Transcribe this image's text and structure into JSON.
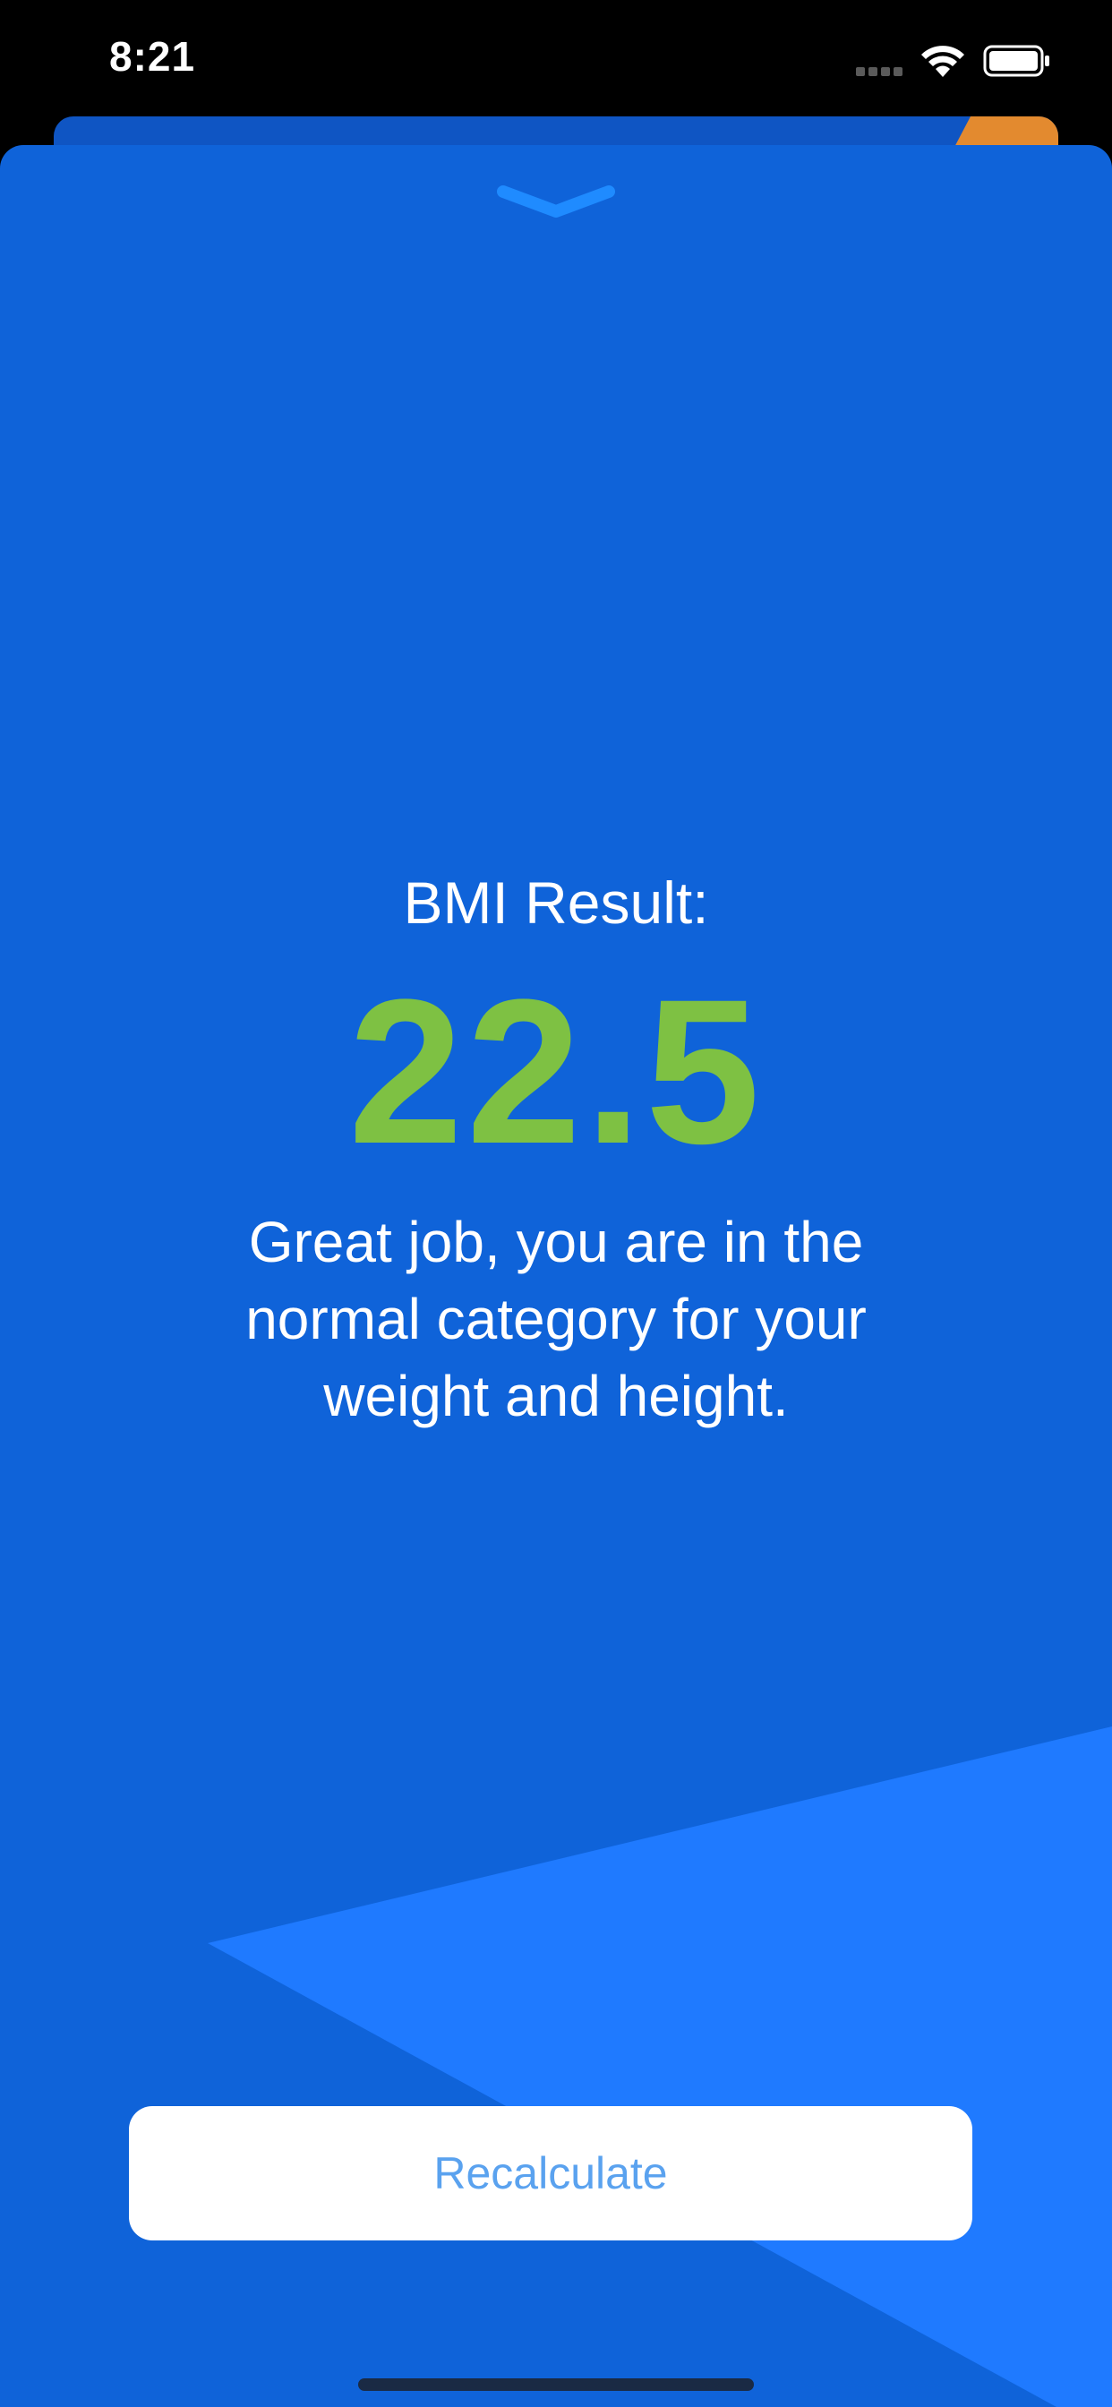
{
  "status_bar": {
    "time": "8:21",
    "icons": [
      "signal-icon",
      "wifi-icon",
      "battery-icon"
    ]
  },
  "result": {
    "title": "BMI Result:",
    "value": "22.5",
    "message": "Great job, you are in the normal category for your weight and height."
  },
  "actions": {
    "recalculate_label": "Recalculate"
  },
  "colors": {
    "sheet_background": "#0f63d9",
    "accent_shape": "#1f7aff",
    "value_color": "#7ec143",
    "back_card_accent": "#e38a2f",
    "button_text": "#5aa2ef"
  }
}
